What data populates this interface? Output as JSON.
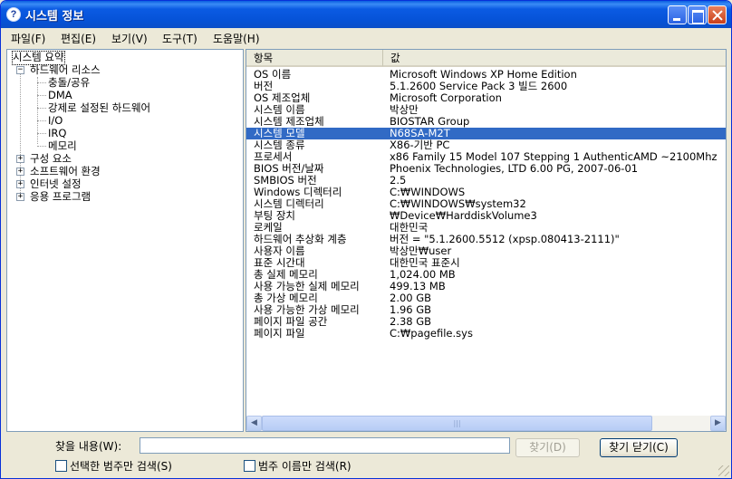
{
  "window": {
    "title": "시스템 정보",
    "title_icon": "?"
  },
  "menu": [
    {
      "label": "파일(F)"
    },
    {
      "label": "편집(E)"
    },
    {
      "label": "보기(V)"
    },
    {
      "label": "도구(T)"
    },
    {
      "label": "도움말(H)"
    }
  ],
  "tree": {
    "root": "시스템 요약",
    "hardware": {
      "label": "하드웨어 리소스",
      "expander": "−",
      "children": [
        "충돌/공유",
        "DMA",
        "강제로 설정된 하드웨어",
        "I/O",
        "IRQ",
        "메모리"
      ]
    },
    "others": [
      {
        "label": "구성 요소",
        "expander": "+"
      },
      {
        "label": "소프트웨어 환경",
        "expander": "+"
      },
      {
        "label": "인터넷 설정",
        "expander": "+"
      },
      {
        "label": "응용 프로그램",
        "expander": "+"
      }
    ]
  },
  "table": {
    "headers": {
      "item": "항목",
      "value": "값"
    },
    "rows": [
      {
        "k": "OS 이름",
        "v": "Microsoft Windows XP Home Edition"
      },
      {
        "k": "버전",
        "v": "5.1.2600 Service Pack 3 빌드 2600"
      },
      {
        "k": "OS 제조업체",
        "v": "Microsoft Corporation"
      },
      {
        "k": "시스템 이름",
        "v": "박상만"
      },
      {
        "k": "시스템 제조업체",
        "v": "BIOSTAR Group"
      },
      {
        "k": "시스템 모델",
        "v": "N68SA-M2T"
      },
      {
        "k": "시스템 종류",
        "v": "X86-기반 PC"
      },
      {
        "k": "프로세서",
        "v": "x86 Family 15 Model 107 Stepping 1 AuthenticAMD ~2100Mhz"
      },
      {
        "k": "BIOS 버전/날짜",
        "v": "Phoenix Technologies, LTD 6.00 PG, 2007-06-01"
      },
      {
        "k": "SMBIOS 버전",
        "v": "2.5"
      },
      {
        "k": "Windows 디렉터리",
        "v": "C:₩WINDOWS"
      },
      {
        "k": "시스템 디렉터리",
        "v": "C:₩WINDOWS₩system32"
      },
      {
        "k": "부팅 장치",
        "v": "₩Device₩HarddiskVolume3"
      },
      {
        "k": "로케일",
        "v": "대한민국"
      },
      {
        "k": "하드웨어 추상화 계층",
        "v": "버전 = \"5.1.2600.5512 (xpsp.080413-2111)\""
      },
      {
        "k": "사용자 이름",
        "v": "박상만₩user"
      },
      {
        "k": "표준 시간대",
        "v": "대한민국 표준시"
      },
      {
        "k": "총 실제 메모리",
        "v": "1,024.00 MB"
      },
      {
        "k": "사용 가능한 실제 메모리",
        "v": "499.13 MB"
      },
      {
        "k": "총 가상 메모리",
        "v": "2.00 GB"
      },
      {
        "k": "사용 가능한 가상 메모리",
        "v": "1.96 GB"
      },
      {
        "k": "페이지 파일 공간",
        "v": "2.38 GB"
      },
      {
        "k": "페이지 파일",
        "v": "C:₩pagefile.sys"
      }
    ],
    "selected_index": 5
  },
  "scrollbar": {
    "left_arrow": "◀",
    "right_arrow": "▶",
    "thumb_grip": "|||"
  },
  "find": {
    "label": "찾을 내용(W):",
    "value": "",
    "find_button": "찾기(D)",
    "close_button": "찾기 닫기(C)",
    "check_selected": "선택한 범주만 검색(S)",
    "check_names": "범주 이름만 검색(R)"
  },
  "colors": {
    "selection": "#316AC5",
    "titlebar": "#0653D8"
  }
}
